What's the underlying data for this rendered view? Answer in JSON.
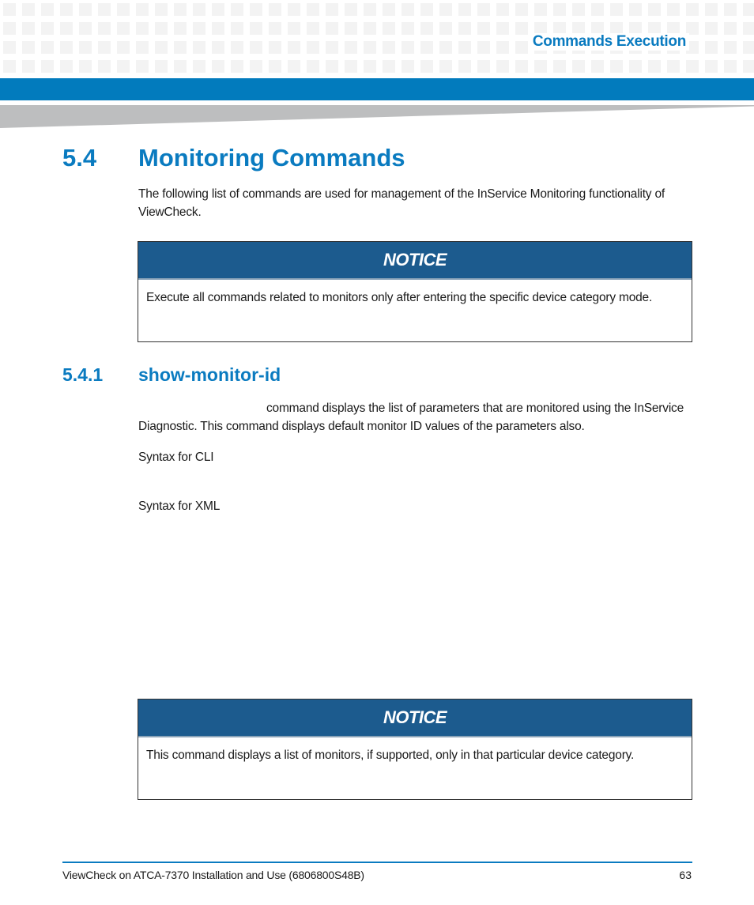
{
  "header": {
    "chapter_title": "Commands Execution"
  },
  "colors": {
    "brand_blue": "#027bbd",
    "heading_blue": "#0a7bc0",
    "notice_header": "#1c5b8e",
    "wedge_grey": "#bdbebf",
    "grid_grey": "#f3f3f3"
  },
  "section": {
    "number": "5.4",
    "title": "Monitoring Commands",
    "intro": "The following list of commands are used for management of the InService Monitoring functionality of ViewCheck."
  },
  "notices": [
    {
      "title": "NOTICE",
      "body": "Execute all commands related to monitors only after entering the specific device category mode."
    },
    {
      "title": "NOTICE",
      "body": "This command displays a list of monitors, if supported, only in that particular device category."
    }
  ],
  "subsection": {
    "number": "5.4.1",
    "title": "show-monitor-id",
    "description": "command displays the list of parameters that are monitored using the InService Diagnostic. This command displays default monitor ID values of the parameters also.",
    "syntax_cli_label": "Syntax for CLI",
    "syntax_xml_label": "Syntax for XML"
  },
  "footer": {
    "document_title": "ViewCheck on ATCA-7370 Installation and Use (6806800S48B)",
    "page_number": "63"
  }
}
